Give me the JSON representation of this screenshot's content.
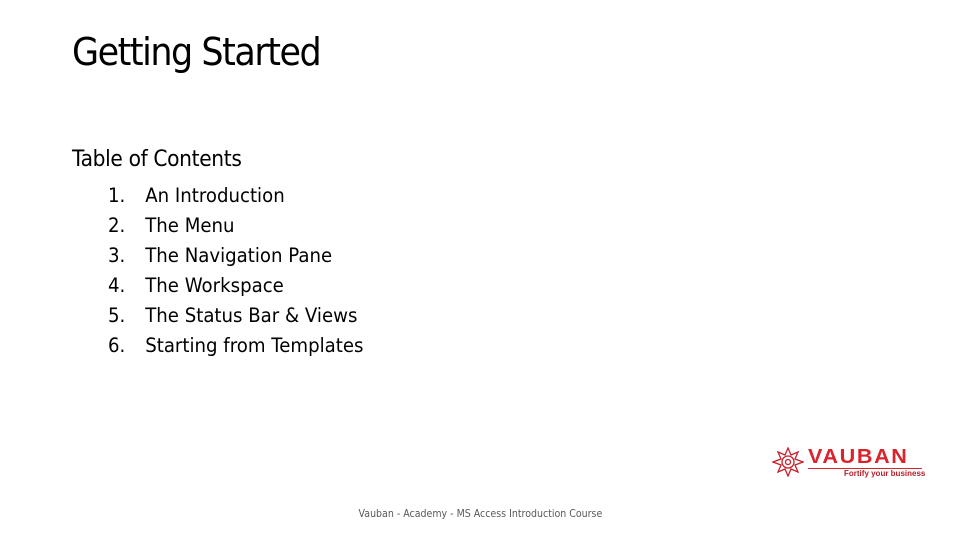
{
  "slide": {
    "title": "Getting Started",
    "toc": {
      "heading": "Table of Contents",
      "items": [
        {
          "number": "1.",
          "label": "An Introduction"
        },
        {
          "number": "2.",
          "label": "The Menu"
        },
        {
          "number": "3.",
          "label": "The Navigation Pane"
        },
        {
          "number": "4.",
          "label": "The Workspace"
        },
        {
          "number": "5.",
          "label": "The Status Bar & Views"
        },
        {
          "number": "6.",
          "label": "Starting from Templates"
        }
      ]
    },
    "logo": {
      "name": "VAUBAN",
      "tagline": "Fortify your business",
      "icon": "star-emblem-icon",
      "brand_color": "#d9232d"
    },
    "footer": "Vauban - Academy - MS Access Introduction Course"
  }
}
